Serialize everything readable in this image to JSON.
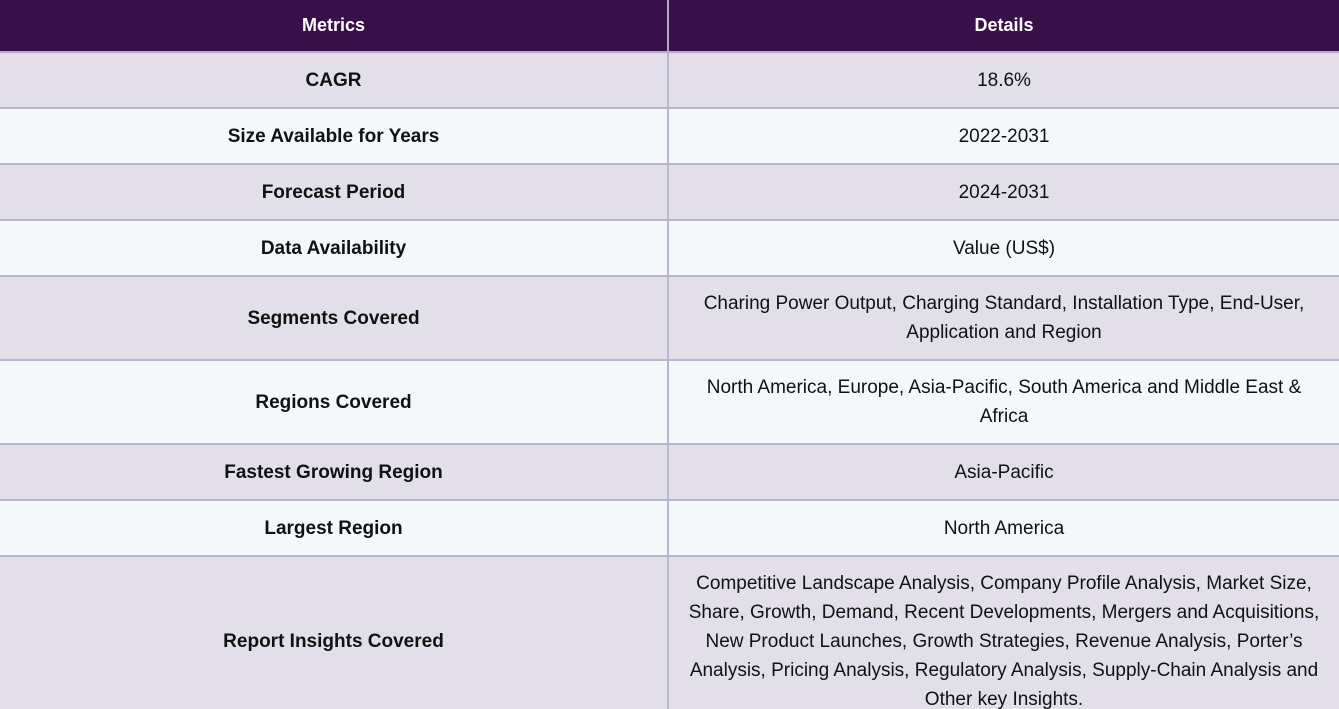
{
  "header": {
    "metrics_label": "Metrics",
    "details_label": "Details"
  },
  "rows": [
    {
      "metric": "CAGR",
      "detail": "18.6%"
    },
    {
      "metric": "Size Available for Years",
      "detail": "2022-2031"
    },
    {
      "metric": "Forecast Period",
      "detail": "2024-2031"
    },
    {
      "metric": "Data Availability",
      "detail": "Value (US$)"
    },
    {
      "metric": "Segments Covered",
      "detail": "Charing Power Output, Charging Standard, Installation Type, End-User, Application and Region"
    },
    {
      "metric": "Regions Covered",
      "detail": "North America, Europe, Asia-Pacific, South America and Middle East & Africa"
    },
    {
      "metric": "Fastest Growing Region",
      "detail": "Asia-Pacific"
    },
    {
      "metric": "Largest Region",
      "detail": "North America"
    },
    {
      "metric": "Report Insights Covered",
      "detail": "Competitive Landscape Analysis, Company Profile Analysis, Market Size, Share, Growth, Demand, Recent Developments, Mergers and Acquisitions, New Product Launches, Growth Strategies, Revenue Analysis, Porter’s Analysis, Pricing Analysis, Regulatory Analysis, Supply-Chain Analysis and Other key Insights."
    }
  ],
  "colors": {
    "header_bg": "#3a1049",
    "row_odd_bg": "#e2deea",
    "row_even_bg": "#f4f8fb"
  }
}
